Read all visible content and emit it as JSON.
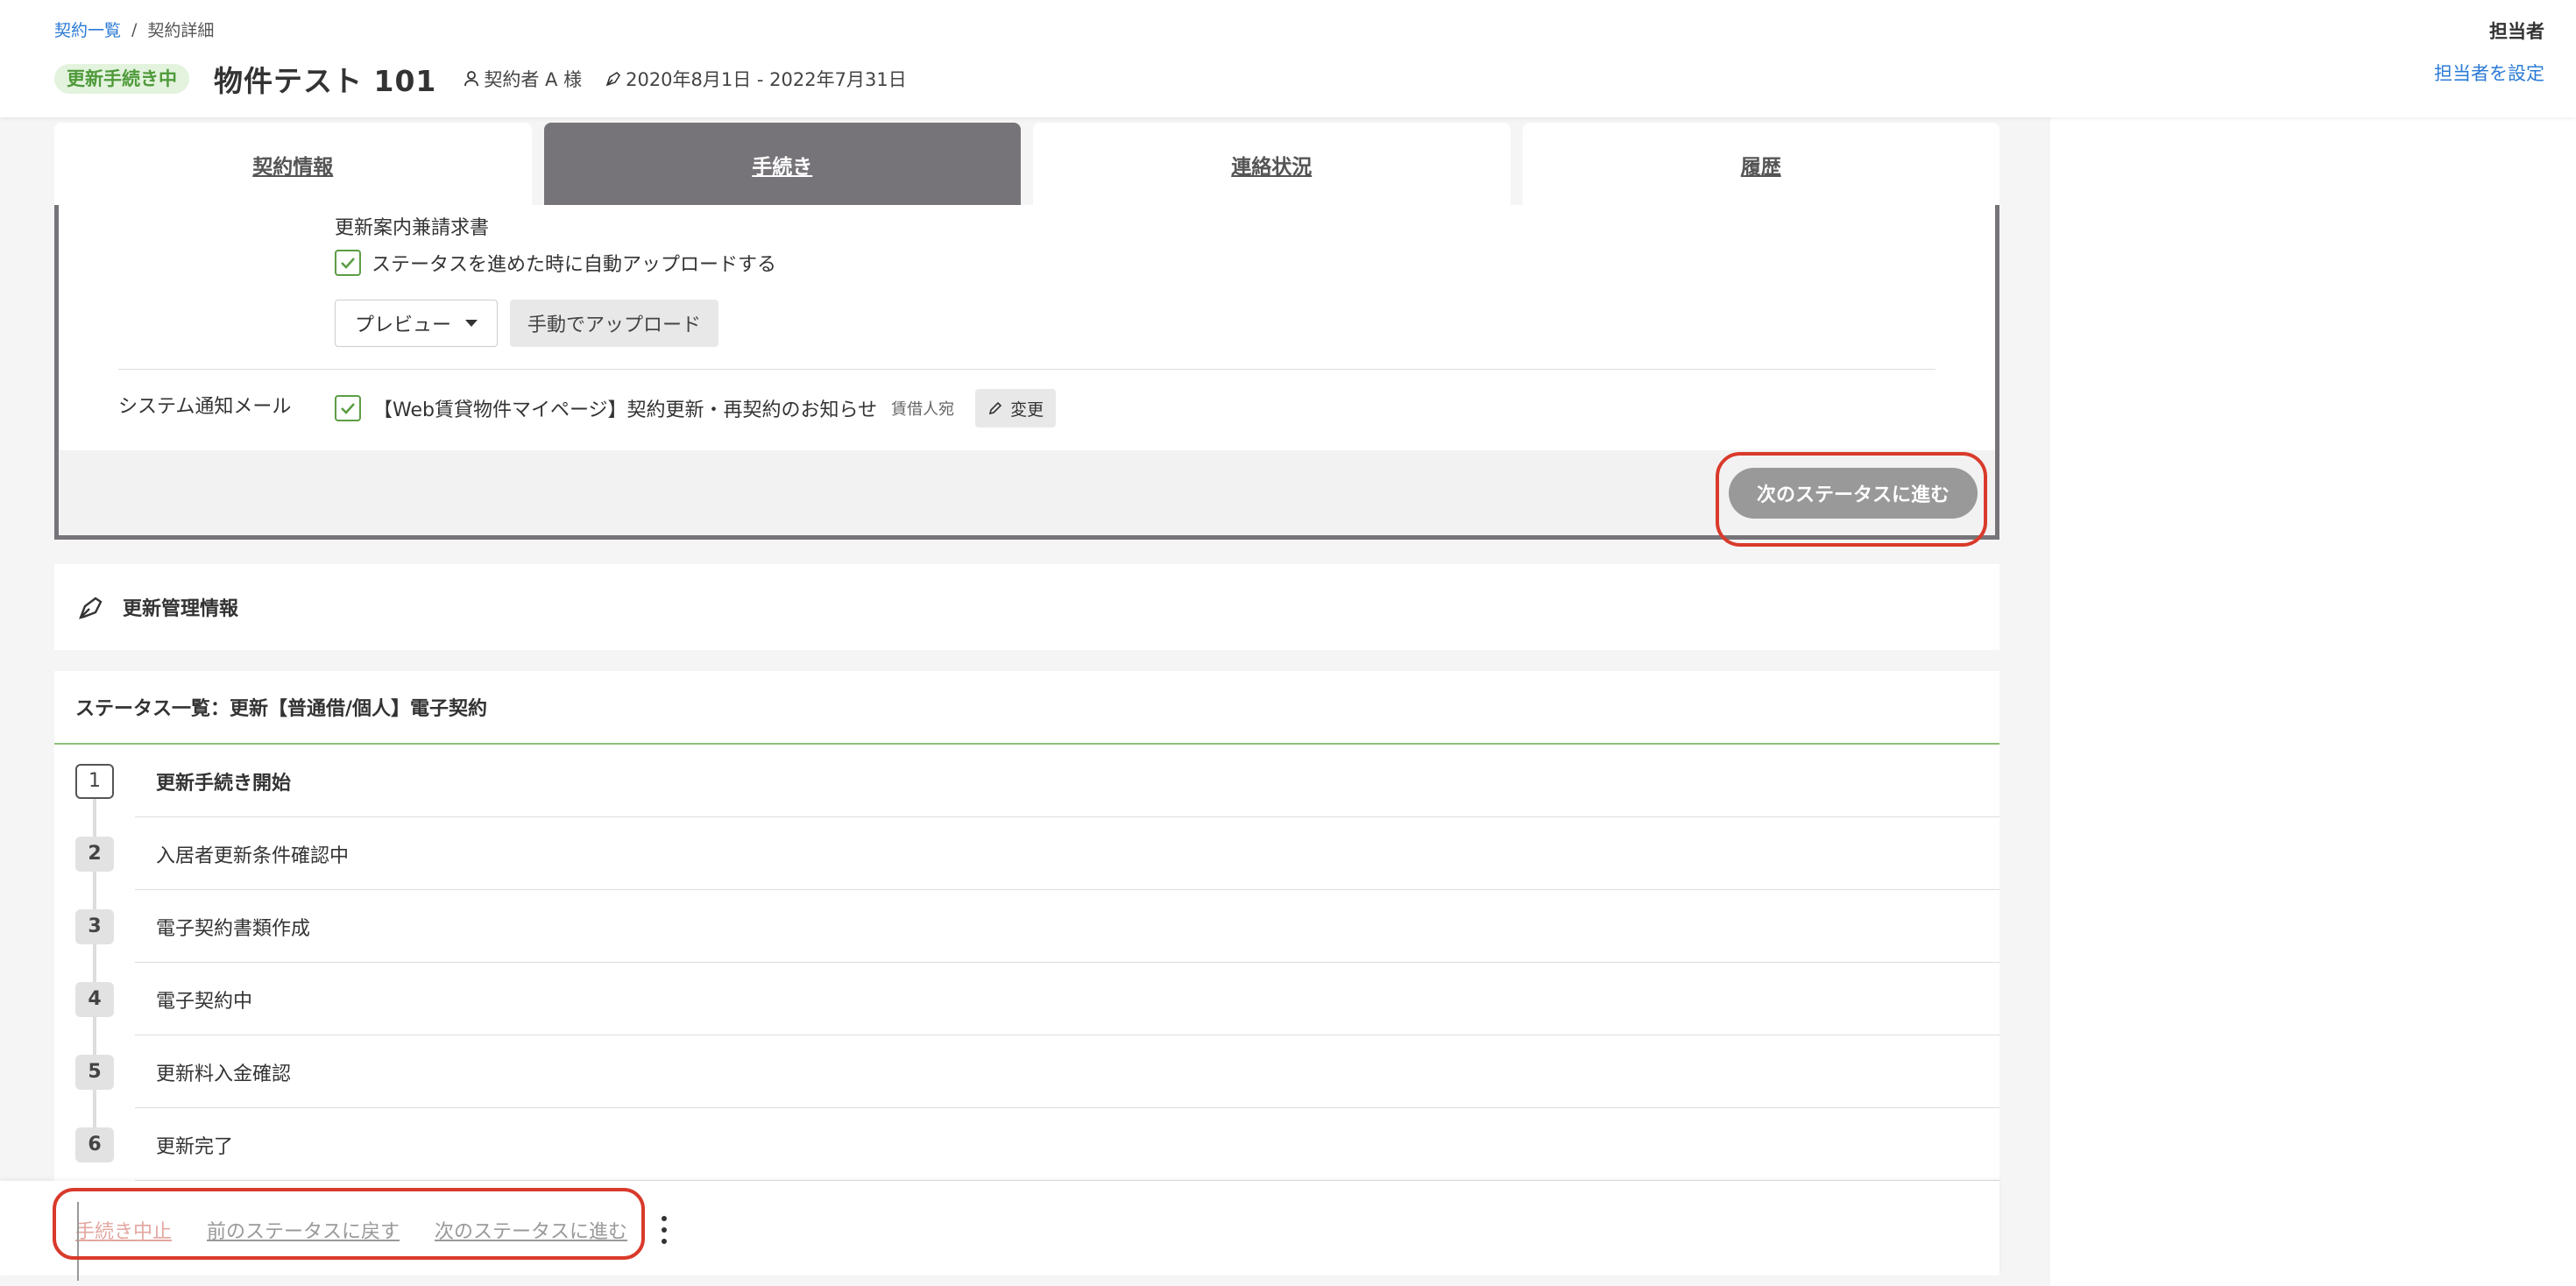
{
  "breadcrumb": {
    "parent": "契約一覧",
    "separator": "/",
    "current": "契約詳細"
  },
  "header": {
    "badge": "更新手続き中",
    "title": "物件テスト 101",
    "contractor": "契約者 A 様",
    "period": "2020年8月1日 - 2022年7月31日",
    "assignee_label": "担当者",
    "assignee_link": "担当者を設定"
  },
  "tabs": [
    {
      "label": "契約情報",
      "active": false
    },
    {
      "label": "手続き",
      "active": true
    },
    {
      "label": "連絡状況",
      "active": false
    },
    {
      "label": "履歴",
      "active": false
    }
  ],
  "procedure": {
    "document_label": "更新案内兼請求書",
    "auto_upload_label": "ステータスを進めた時に自動アップロードする",
    "auto_upload_checked": true,
    "preview_label": "プレビュー",
    "manual_upload_label": "手動でアップロード",
    "notify_label": "システム通知メール",
    "notify_checked": true,
    "notify_title": "【Web賃貸物件マイページ】契約更新・再契約のお知らせ",
    "notify_recipient": "賃借人宛",
    "change_label": "変更",
    "next_status_label": "次のステータスに進む"
  },
  "management": {
    "title": "更新管理情報"
  },
  "status_list": {
    "title": "ステータス一覧：更新【普通借/個人】電子契約",
    "current_step": 1,
    "steps": [
      {
        "num": "1",
        "label": "更新手続き開始"
      },
      {
        "num": "2",
        "label": "入居者更新条件確認中"
      },
      {
        "num": "3",
        "label": "電子契約書類作成"
      },
      {
        "num": "4",
        "label": "電子契約中"
      },
      {
        "num": "5",
        "label": "更新料入金確認"
      },
      {
        "num": "6",
        "label": "更新完了"
      }
    ]
  },
  "actions": {
    "cancel": "手続き中止",
    "prev": "前のステータスに戻す",
    "next": "次のステータスに進む"
  },
  "colors": {
    "accent_link": "#2b7bd6",
    "badge_green": "#4f9a3a",
    "highlight_red": "#d93a2b",
    "active_tab": "#777479"
  }
}
